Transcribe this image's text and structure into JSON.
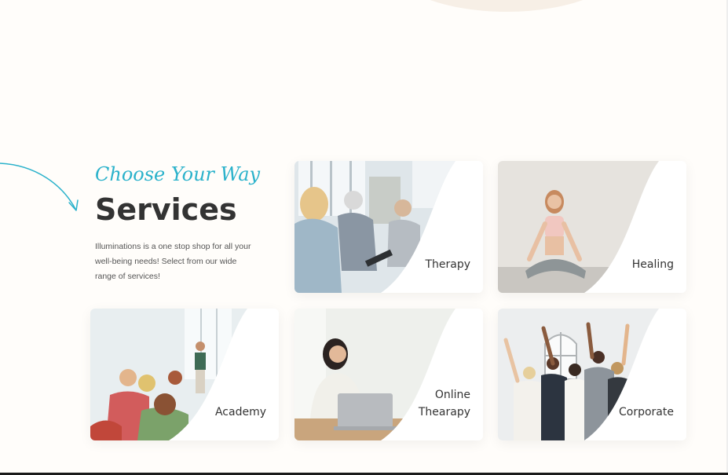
{
  "services": {
    "tagline": "Choose Your Way",
    "title": "Services",
    "description": "Illuminations is a one stop shop for all your well-being needs! Select from our wide range of services!",
    "cards": [
      {
        "id": "therapy",
        "label": "Therapy"
      },
      {
        "id": "healing",
        "label": "Healing"
      },
      {
        "id": "academy",
        "label": "Academy"
      },
      {
        "id": "online-therapy",
        "label_lines": [
          "Online",
          "Thearapy"
        ]
      },
      {
        "id": "corporate",
        "label": "Corporate"
      }
    ]
  },
  "colors": {
    "accent": "#2bb2cb",
    "heading": "#333333",
    "page_bg": "#fffdfa"
  }
}
